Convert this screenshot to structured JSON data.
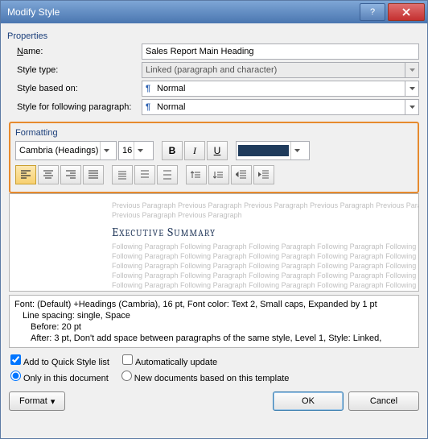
{
  "window": {
    "title": "Modify Style"
  },
  "properties": {
    "section_label": "Properties",
    "name_label": "Name:",
    "name_value": "Sales Report Main Heading",
    "type_label": "Style type:",
    "type_value": "Linked (paragraph and character)",
    "based_label": "Style based on:",
    "based_value": "Normal",
    "follow_label": "Style for following paragraph:",
    "follow_value": "Normal"
  },
  "formatting": {
    "section_label": "Formatting",
    "font_name": "Cambria (Headings)",
    "font_size": "16",
    "bold": "B",
    "italic": "I",
    "underline": "U",
    "color": "#1f3b5c"
  },
  "preview": {
    "prev_para": "Previous Paragraph Previous Paragraph Previous Paragraph Previous Paragraph Previous Paragraph",
    "prev_para2": "Previous Paragraph Previous Paragraph",
    "heading": "Executive Summary",
    "follow_para": "Following Paragraph Following Paragraph Following Paragraph Following Paragraph Following Paragraph"
  },
  "description": {
    "line1": "Font: (Default) +Headings (Cambria), 16 pt, Font color: Text 2, Small caps, Expanded by  1 pt",
    "line2": "Line spacing:  single, Space",
    "line3": "Before:  20 pt",
    "line4": "After:  3 pt, Don't add space between paragraphs of the same style, Level 1, Style: Linked,"
  },
  "options": {
    "quick_style": "Add to Quick Style list",
    "auto_update": "Automatically update",
    "only_doc": "Only in this document",
    "new_template": "New documents based on this template"
  },
  "buttons": {
    "format": "Format",
    "ok": "OK",
    "cancel": "Cancel"
  }
}
